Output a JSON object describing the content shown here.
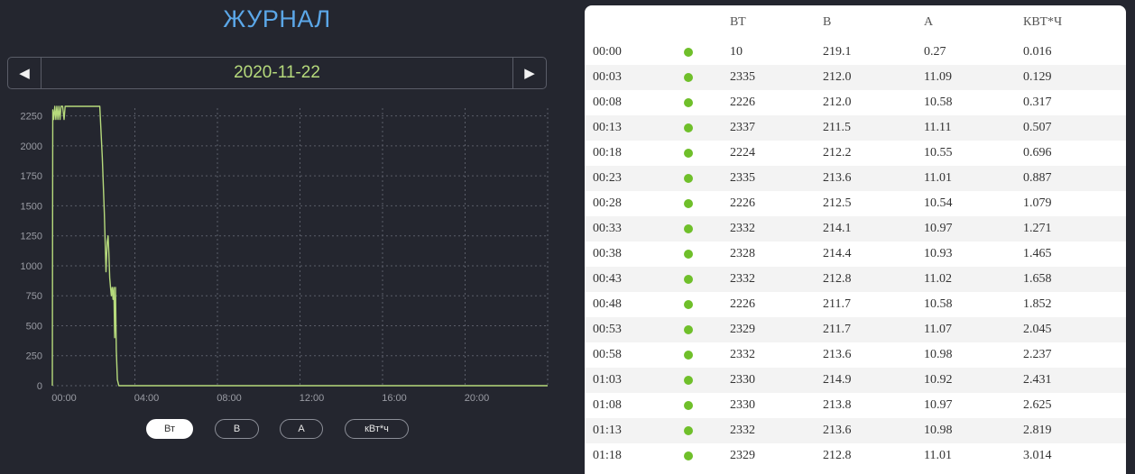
{
  "header": {
    "title": "ЖУРНАЛ"
  },
  "date_nav": {
    "prev_icon": "◀",
    "date": "2020-11-22",
    "next_icon": "▶"
  },
  "chart_data": {
    "type": "line",
    "ylim": [
      0,
      2300
    ],
    "y_ticks": [
      "0",
      "250",
      "500",
      "750",
      "1000",
      "1250",
      "1500",
      "1750",
      "2000",
      "2250"
    ],
    "x_ticks": [
      "00:00",
      "04:00",
      "08:00",
      "12:00",
      "16:00",
      "20:00"
    ],
    "xlim_hours": [
      0,
      24
    ],
    "grid": true,
    "line_color": "#b6da7c",
    "series": [
      {
        "values": [
          [
            0,
            0
          ],
          [
            0.02,
            2300
          ],
          [
            0.07,
            2220
          ],
          [
            0.12,
            2330
          ],
          [
            0.17,
            2220
          ],
          [
            0.22,
            2330
          ],
          [
            0.27,
            2220
          ],
          [
            0.32,
            2330
          ],
          [
            0.37,
            2220
          ],
          [
            0.42,
            2330
          ],
          [
            0.5,
            2330
          ],
          [
            0.57,
            2220
          ],
          [
            0.62,
            2330
          ],
          [
            1,
            2330
          ],
          [
            1.5,
            2330
          ],
          [
            2.3,
            2330
          ],
          [
            2.42,
            1900
          ],
          [
            2.52,
            1450
          ],
          [
            2.6,
            950
          ],
          [
            2.66,
            1200
          ],
          [
            2.7,
            1250
          ],
          [
            2.74,
            1100
          ],
          [
            2.78,
            900
          ],
          [
            2.82,
            820
          ],
          [
            2.86,
            750
          ],
          [
            2.9,
            820
          ],
          [
            2.94,
            720
          ],
          [
            2.98,
            820
          ],
          [
            3.02,
            400
          ],
          [
            3.06,
            820
          ],
          [
            3.1,
            300
          ],
          [
            3.15,
            50
          ],
          [
            3.22,
            0
          ],
          [
            24,
            0
          ]
        ]
      }
    ]
  },
  "toggles": [
    {
      "label": "Вт",
      "active": true
    },
    {
      "label": "В",
      "active": false
    },
    {
      "label": "А",
      "active": false
    },
    {
      "label": "кВт*ч",
      "active": false
    }
  ],
  "table": {
    "headers": [
      "",
      "",
      "ВТ",
      "В",
      "А",
      "КВТ*Ч"
    ],
    "status_color": "#6fbf2a",
    "rows": [
      [
        "00:00",
        "10",
        "219.1",
        "0.27",
        "0.016"
      ],
      [
        "00:03",
        "2335",
        "212.0",
        "11.09",
        "0.129"
      ],
      [
        "00:08",
        "2226",
        "212.0",
        "10.58",
        "0.317"
      ],
      [
        "00:13",
        "2337",
        "211.5",
        "11.11",
        "0.507"
      ],
      [
        "00:18",
        "2224",
        "212.2",
        "10.55",
        "0.696"
      ],
      [
        "00:23",
        "2335",
        "213.6",
        "11.01",
        "0.887"
      ],
      [
        "00:28",
        "2226",
        "212.5",
        "10.54",
        "1.079"
      ],
      [
        "00:33",
        "2332",
        "214.1",
        "10.97",
        "1.271"
      ],
      [
        "00:38",
        "2328",
        "214.4",
        "10.93",
        "1.465"
      ],
      [
        "00:43",
        "2332",
        "212.8",
        "11.02",
        "1.658"
      ],
      [
        "00:48",
        "2226",
        "211.7",
        "10.58",
        "1.852"
      ],
      [
        "00:53",
        "2329",
        "211.7",
        "11.07",
        "2.045"
      ],
      [
        "00:58",
        "2332",
        "213.6",
        "10.98",
        "2.237"
      ],
      [
        "01:03",
        "2330",
        "214.9",
        "10.92",
        "2.431"
      ],
      [
        "01:08",
        "2330",
        "213.8",
        "10.97",
        "2.625"
      ],
      [
        "01:13",
        "2332",
        "213.6",
        "10.98",
        "2.819"
      ],
      [
        "01:18",
        "2329",
        "212.8",
        "11.01",
        "3.014"
      ]
    ]
  }
}
